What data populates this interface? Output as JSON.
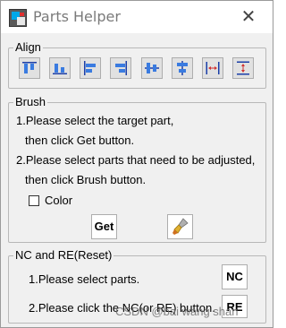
{
  "window": {
    "title": "Parts Helper",
    "close_glyph": "✕"
  },
  "align": {
    "label": "Align",
    "buttons": [
      {
        "icon": "align-top-icon"
      },
      {
        "icon": "align-bottom-icon"
      },
      {
        "icon": "align-left-icon"
      },
      {
        "icon": "align-right-icon"
      },
      {
        "icon": "center-horizontal-icon"
      },
      {
        "icon": "center-vertical-icon"
      },
      {
        "icon": "distribute-horizontal-icon"
      },
      {
        "icon": "distribute-vertical-icon"
      }
    ]
  },
  "brush": {
    "label": "Brush",
    "lines": [
      "1.Please select the target part,",
      "then click Get button.",
      "2.Please select parts that need to be adjusted,",
      "then click Brush button."
    ],
    "color_label": "Color",
    "color_checked": false,
    "get_label": "Get",
    "brush_icon": "paintbrush-icon"
  },
  "ncre": {
    "label": "NC and RE(Reset)",
    "line1": "1.Please select parts.",
    "line2": "2.Please click the NC(or RE) button.",
    "nc_label": "NC",
    "re_label": "RE"
  },
  "watermark": "CSDN @bai wang shan"
}
